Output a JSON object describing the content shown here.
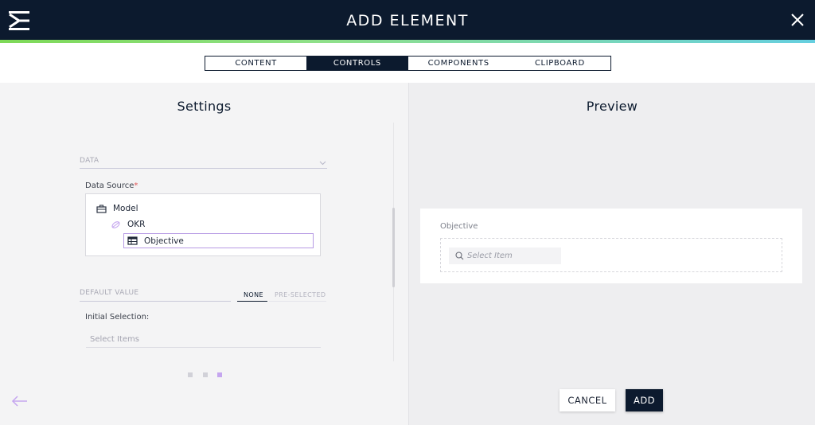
{
  "header": {
    "title": "ADD ELEMENT",
    "logo_icon": "app-logo-icon",
    "close_icon": "close-icon",
    "accent_colors": [
      "#7ed957",
      "#66cfe0"
    ],
    "bg_color": "#0c1a2e"
  },
  "tabs": [
    {
      "label": "CONTENT",
      "active": false
    },
    {
      "label": "CONTROLS",
      "active": true
    },
    {
      "label": "COMPONENTS",
      "active": false
    },
    {
      "label": "CLIPBOARD",
      "active": false
    }
  ],
  "settings": {
    "title": "Settings",
    "data_section_label": "DATA",
    "data_source_label": "Data Source",
    "required_marker": "*",
    "tree": [
      {
        "label": "Model",
        "icon": "briefcase-icon",
        "selected": false
      },
      {
        "label": "OKR",
        "icon": "link-icon",
        "selected": false
      },
      {
        "label": "Objective",
        "icon": "table-icon",
        "selected": true
      }
    ],
    "default_value_label": "DEFAULT VALUE",
    "default_value_options": [
      {
        "label": "NONE",
        "active": true
      },
      {
        "label": "PRE-SELECTED",
        "active": false
      }
    ],
    "initial_selection_label": "Initial Selection:",
    "initial_selection_placeholder": "Select Items",
    "pagination": {
      "total": 3,
      "active": 3
    }
  },
  "preview": {
    "title": "Preview",
    "field_label": "Objective",
    "search_placeholder": "Select Item"
  },
  "footer": {
    "cancel_label": "CANCEL",
    "add_label": "ADD",
    "back_icon": "arrow-left-icon"
  }
}
